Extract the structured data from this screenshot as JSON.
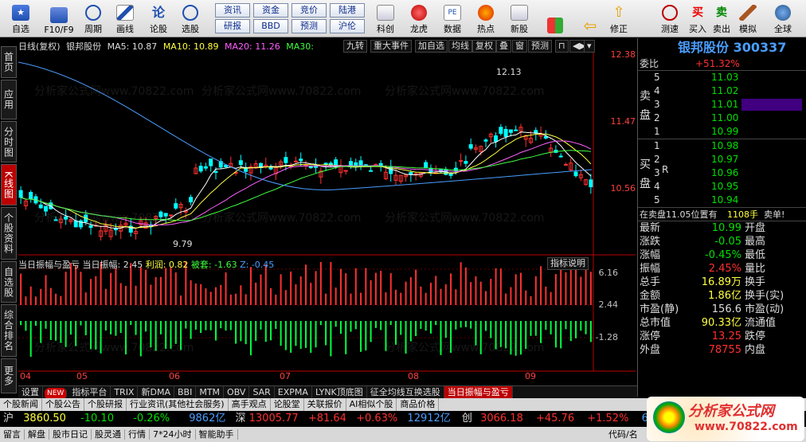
{
  "toolbar": {
    "items": [
      {
        "label": "自选",
        "icon": "star-icon"
      },
      {
        "label": "F10/F9",
        "icon": "f10-icon"
      },
      {
        "label": "周期",
        "icon": "clock-icon"
      },
      {
        "label": "画线",
        "icon": "pen-icon"
      },
      {
        "label": "论股",
        "icon": "discuss-icon"
      },
      {
        "label": "选股",
        "icon": "select-icon"
      }
    ],
    "small_buttons": [
      "资讯",
      "资金",
      "竞价",
      "陆港",
      "研报",
      "BBD",
      "预测",
      "沪伦"
    ],
    "items2": [
      {
        "label": "科创",
        "icon": "chart-icon"
      },
      {
        "label": "龙虎",
        "icon": "dragon-icon"
      },
      {
        "label": "数据",
        "icon": "pe-icon"
      },
      {
        "label": "热点",
        "icon": "hot-icon"
      },
      {
        "label": "新股",
        "icon": "newstock-icon"
      }
    ],
    "items3": [
      {
        "label": "修正",
        "icon": "back-icon"
      },
      {
        "label": "测速",
        "icon": "speed-icon"
      },
      {
        "label": "买入",
        "icon": "buy-icon"
      },
      {
        "label": "卖出",
        "icon": "sell-icon"
      },
      {
        "label": "模拟",
        "icon": "hammer-icon"
      },
      {
        "label": "全球",
        "icon": "globe-icon"
      }
    ]
  },
  "sidetabs": [
    "首页",
    "应用",
    "分时图",
    "K线图",
    "个股资料",
    "自选股",
    "综合排名",
    "更多"
  ],
  "kline_info": {
    "period": "日线(复权)",
    "stock": "银邦股份",
    "ma5": "MA5: 10.87",
    "ma10": "MA10: 10.89",
    "ma20": "MA20: 11.26",
    "ma30": "MA30: "
  },
  "chart_tools": [
    "九转",
    "重大事件",
    "加自选",
    "均线",
    "复权",
    "叠",
    "窗",
    "预测"
  ],
  "price_axis": [
    "12.38",
    "11.47",
    "10.56"
  ],
  "price_marks": {
    "high": "12.13",
    "low": "9.79"
  },
  "ind_info": {
    "name": "当日振幅与盈亏",
    "amp": "当日振幅: 2.45",
    "profit": "利润: 0.82",
    "trap": "被套: -1.63",
    "z": "Z: -0.45"
  },
  "ind_button": "指标说明",
  "ind_axis": [
    "6.16",
    "2.44",
    "-1.28"
  ],
  "date_labels": [
    "04",
    "05",
    "06",
    "07",
    "08",
    "09"
  ],
  "bottom_tabs": [
    "设置",
    "NEW",
    "指标平台",
    "TRIX",
    "新DMA",
    "BBI",
    "MTM",
    "OBV",
    "SAR",
    "EXPMA",
    "LYNK顶底图",
    "征全均线互换选股",
    "当日振幅与盈亏"
  ],
  "right": {
    "title": "银邦股份 300337",
    "weibi_label": "委比",
    "weibi_value": "+51.32%",
    "sell_label": "卖盘",
    "sells": [
      [
        "5",
        "11.03"
      ],
      [
        "4",
        "11.02"
      ],
      [
        "3",
        "11.01"
      ],
      [
        "2",
        "11.00"
      ],
      [
        "1",
        "10.99"
      ]
    ],
    "buy_label": "买盘",
    "buys": [
      [
        "1",
        "10.98"
      ],
      [
        "2",
        "10.97"
      ],
      [
        "3",
        "10.96"
      ],
      [
        "4",
        "10.95"
      ],
      [
        "5",
        "10.94"
      ]
    ],
    "r_label": "R",
    "notice": "在卖盘11.05位置有",
    "notice_vol": "1108手",
    "notice_tail": "卖单!",
    "stats": [
      [
        "最新",
        "10.99",
        "开盘"
      ],
      [
        "涨跌",
        "-0.05",
        "最高"
      ],
      [
        "涨幅",
        "-0.45%",
        "最低"
      ],
      [
        "振幅",
        "2.45%",
        "量比"
      ],
      [
        "总手",
        "16.89万",
        "换手"
      ],
      [
        "金额",
        "1.86亿",
        "换手(实)"
      ],
      [
        "市盈(静)",
        "156.6",
        "市盈(动)"
      ],
      [
        "总市值",
        "90.33亿",
        "流通值"
      ],
      [
        "涨停",
        "13.25",
        "跌停"
      ],
      [
        "外盘",
        "78755",
        "内盘"
      ]
    ]
  },
  "news_tabs": [
    "个股新闻",
    "个股公告",
    "个股研报",
    "行业资讯(其他社会服务)",
    "高手观点",
    "论股堂",
    "关联报价",
    "AI相似个股",
    "商品价格"
  ],
  "ticker": {
    "sh": {
      "label": "沪",
      "price": "3860.50",
      "chg": "-10.10",
      "pct": "-0.26%",
      "amt": "9862亿"
    },
    "sz": {
      "label": "深",
      "price": "13005.77",
      "chg": "+81.64",
      "pct": "+0.63%",
      "amt": "12912亿"
    },
    "cy": {
      "label": "创",
      "price": "3066.18",
      "chg": "+45.76",
      "pct": "+1.52%",
      "amt": "6208"
    }
  },
  "status": [
    "留言",
    "解盘",
    "股市日记",
    "股灵通",
    "行情",
    "7*24小时",
    "智能助手",
    "代码/名"
  ],
  "watermark": "分析家公式网www.70822.com",
  "logo": {
    "text": "分析家公式网",
    "url": "www.70822.com"
  },
  "colors": {
    "up": "#ff3030",
    "down": "#00e000",
    "accent": "#4a9eff",
    "active": "#b00000"
  }
}
